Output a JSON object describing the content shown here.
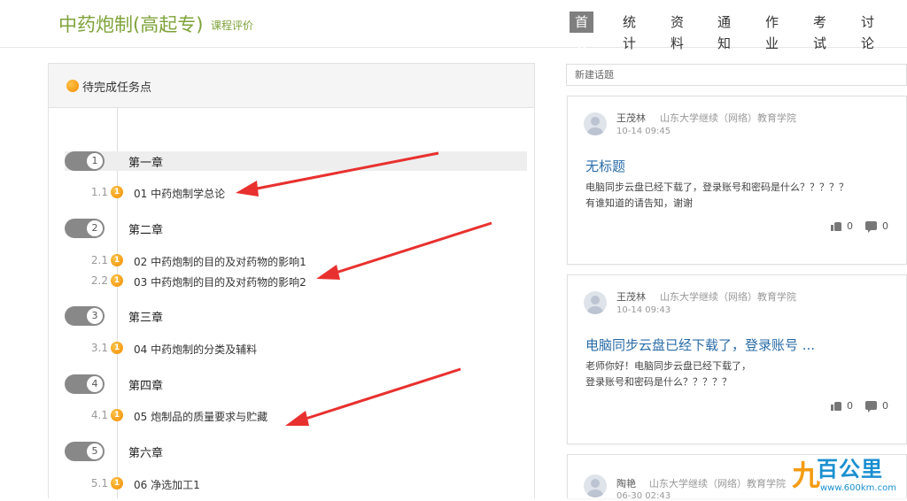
{
  "header": {
    "course_title": "中药炮制(高起专)",
    "course_eval": "课程评价",
    "nav": [
      "首页",
      "统计",
      "资料",
      "通知",
      "作业",
      "考试",
      "讨论"
    ],
    "active_nav": "首页"
  },
  "tasks": {
    "panel_title": "待完成任务点",
    "chapters": [
      {
        "num": "1",
        "label": "第一章",
        "lessons": [
          {
            "num": "1.1",
            "badge": "1",
            "name": "01 中药炮制学总论"
          }
        ]
      },
      {
        "num": "2",
        "label": "第二章",
        "lessons": [
          {
            "num": "2.1",
            "badge": "1",
            "name": "02 中药炮制的目的及对药物的影响1"
          },
          {
            "num": "2.2",
            "badge": "1",
            "name": "03 中药炮制的目的及对药物的影响2"
          }
        ]
      },
      {
        "num": "3",
        "label": "第三章",
        "lessons": [
          {
            "num": "3.1",
            "badge": "1",
            "name": "04 中药炮制的分类及辅料"
          }
        ]
      },
      {
        "num": "4",
        "label": "第四章",
        "lessons": [
          {
            "num": "4.1",
            "badge": "1",
            "name": "05 炮制品的质量要求与贮藏"
          }
        ]
      },
      {
        "num": "5",
        "label": "第六章",
        "lessons": [
          {
            "num": "5.1",
            "badge": "1",
            "name": "06 净选加工1"
          }
        ]
      }
    ]
  },
  "discussion": {
    "new_topic_placeholder": "新建话题",
    "posts": [
      {
        "author": "王茂林",
        "org": "山东大学继续（网络）教育学院",
        "time": "10-14 09:45",
        "title": "无标题",
        "body_lines": [
          "电脑同步云盘已经下载了，登录账号和密码是什么？？？？？",
          "有谁知道的请告知，谢谢"
        ],
        "likes": "0",
        "comments": "0"
      },
      {
        "author": "王茂林",
        "org": "山东大学继续（网络）教育学院",
        "time": "10-14 09:43",
        "title": "电脑同步云盘已经下载了，登录账号 ...",
        "body_lines": [
          "老师你好！电脑同步云盘已经下载了，",
          "登录账号和密码是什么？？？？？"
        ],
        "likes": "0",
        "comments": "0"
      },
      {
        "author": "陶艳",
        "org": "山东大学继续（网络）教育学院",
        "time": "06-30 02:43"
      }
    ]
  },
  "watermark": {
    "brand": "百公里",
    "url": "www.600km.com"
  },
  "colors": {
    "brand_green": "#7ea33a",
    "link_blue": "#2a6ca8",
    "badge_orange": "#f08c00",
    "arrow_red": "#e8312f"
  }
}
